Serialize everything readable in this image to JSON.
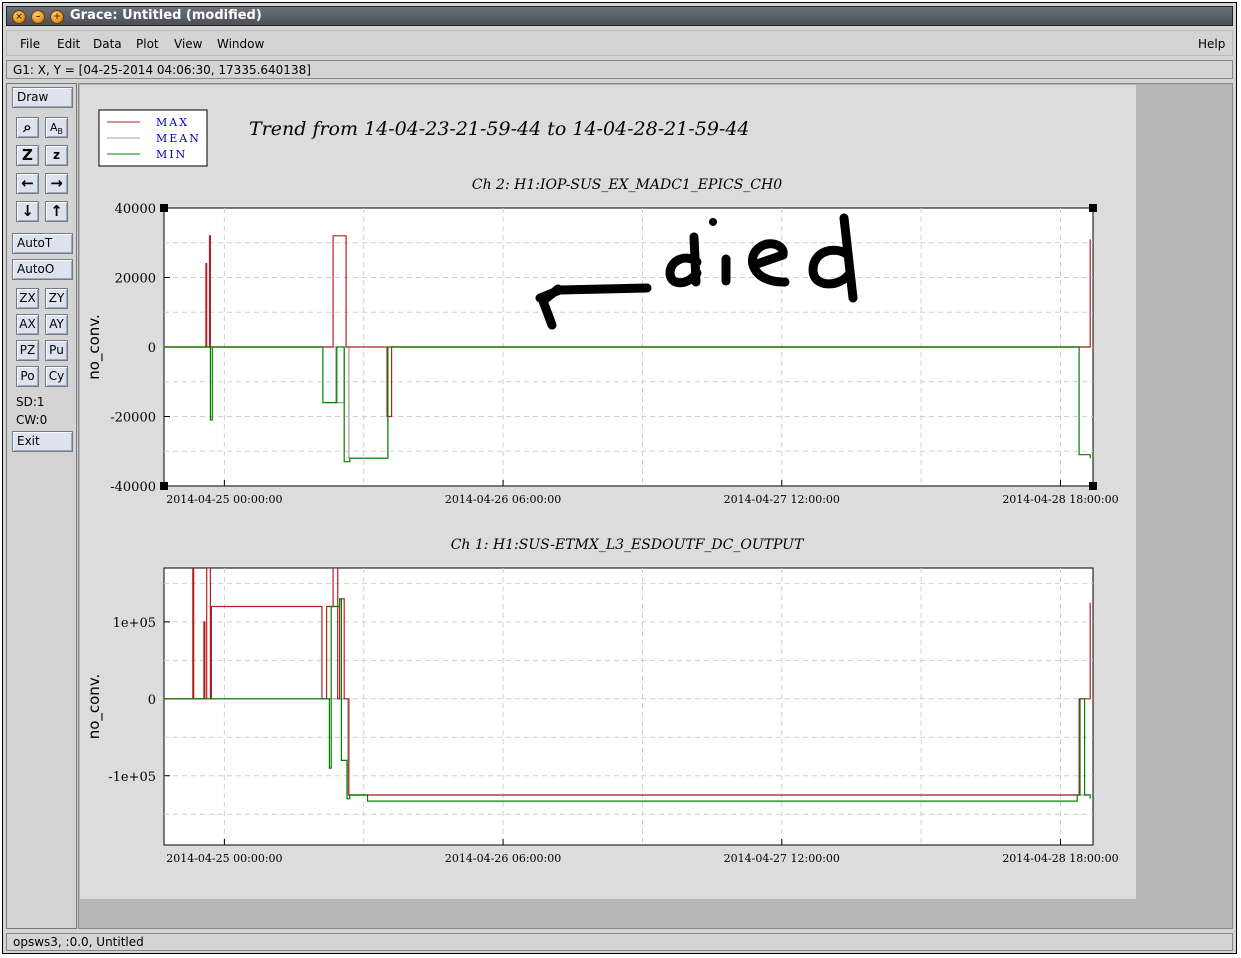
{
  "window": {
    "title": "Grace: Untitled (modified)",
    "buttons": [
      "close",
      "minimize",
      "maximize"
    ]
  },
  "menubar": {
    "items": [
      "File",
      "Edit",
      "Data",
      "Plot",
      "View",
      "Window"
    ],
    "help": "Help"
  },
  "locator": "G1: X, Y = [04-25-2014 04:06:30, 17335.640138]",
  "toolbox": {
    "draw": "Draw",
    "icons": [
      "zoom-icon",
      "text-icon",
      "zoom-in-icon",
      "zoom-out-icon",
      "arrow-left-icon",
      "arrow-right-icon",
      "arrow-down-icon",
      "arrow-up-icon"
    ],
    "autoT": "AutoT",
    "autoO": "AutoO",
    "pairs": [
      [
        "ZX",
        "ZY"
      ],
      [
        "AX",
        "AY"
      ],
      [
        "PZ",
        "Pu"
      ],
      [
        "Po",
        "Cy"
      ]
    ],
    "sd": "SD:1",
    "cw": "CW:0",
    "exit": "Exit"
  },
  "status": "opsws3, :0.0, Untitled",
  "colors": {
    "max": "#b22222",
    "mean": "#a0a0a0",
    "min": "#008000",
    "legend_text": "#0000cc"
  },
  "annotation": "died",
  "chart_data": [
    {
      "type": "line",
      "title": "Trend from 14-04-23-21-59-44 to 14-04-28-21-59-44",
      "subtitle": "Ch 2: H1:IOP-SUS_EX_MADC1_EPICS_CH0",
      "ylabel": "no_conv.",
      "xlabel": "",
      "ylim": [
        -40000,
        40000
      ],
      "yticks": [
        "40000",
        "20000",
        "0",
        "-20000",
        "-40000"
      ],
      "xticks": [
        "2014-04-25 00:00:00",
        "2014-04-26 06:00:00",
        "2014-04-27 12:00:00",
        "2014-04-28 18:00:00"
      ],
      "xlim_hours": [
        -6.5,
        93.5
      ],
      "grid": true,
      "legend": {
        "position": "top-left",
        "entries": [
          "MAX",
          "MEAN",
          "MIN"
        ]
      },
      "series": [
        {
          "name": "MAX",
          "x": [
            -19.6,
            -2.0,
            -1.99,
            -1.9,
            -1.6,
            -1.5,
            10.5,
            11.6,
            11.7,
            12.9,
            13.1,
            13.5,
            17.3,
            17.5,
            18.0,
            91.8,
            92.0,
            93.2
          ],
          "y": [
            0,
            0,
            24000,
            0,
            32000,
            0,
            0,
            0,
            32000,
            32000,
            0,
            0,
            0,
            -20000,
            0,
            0,
            0,
            31000
          ]
        },
        {
          "name": "MEAN",
          "x": [
            -19.6,
            10.5,
            12.0,
            12.9,
            13.4,
            17.5,
            17.6,
            93.2
          ],
          "y": [
            0,
            0,
            -16000,
            0,
            -32000,
            -32000,
            0,
            0
          ]
        },
        {
          "name": "MIN",
          "x": [
            -19.6,
            -2.0,
            -1.5,
            -1.3,
            10.5,
            10.6,
            11.9,
            12.1,
            12.9,
            13.5,
            17.5,
            17.6,
            91.8,
            92.0,
            93.2
          ],
          "y": [
            0,
            0,
            -21000,
            0,
            0,
            -16000,
            -16000,
            0,
            -33000,
            -32000,
            -32000,
            0,
            0,
            -31000,
            -32000
          ]
        }
      ]
    },
    {
      "type": "line",
      "title": "",
      "subtitle": "Ch 1: H1:SUS-ETMX_L3_ESDOUTF_DC_OUTPUT",
      "ylabel": "no_conv.",
      "xlabel": "",
      "ylim": [
        -190000,
        170000
      ],
      "yticks": [
        "1e+05",
        "0",
        "-1e+05"
      ],
      "xticks": [
        "2014-04-25 00:00:00",
        "2014-04-26 06:00:00",
        "2014-04-27 12:00:00",
        "2014-04-28 18:00:00"
      ],
      "xlim_hours": [
        -6.5,
        93.5
      ],
      "grid": true,
      "series": [
        {
          "name": "MAX",
          "x": [
            -19.6,
            -3.5,
            -3.4,
            -3.3,
            -2.2,
            -2.1,
            -1.9,
            -1.5,
            -1.4,
            10.5,
            11.0,
            11.7,
            12.2,
            12.4,
            12.9,
            13.4,
            91.8,
            92.0,
            93.2
          ],
          "y": [
            0,
            0,
            170000,
            0,
            100000,
            0,
            170000,
            0,
            120000,
            0,
            120000,
            170000,
            0,
            130000,
            0,
            -125000,
            -125000,
            0,
            125000
          ]
        },
        {
          "name": "MEAN",
          "x": [
            -19.6,
            11.0,
            12.5,
            13.3,
            93.2
          ],
          "y": [
            0,
            0,
            0,
            -125000,
            -125000
          ]
        },
        {
          "name": "MIN",
          "x": [
            -19.6,
            11.1,
            11.3,
            11.5,
            12.4,
            12.6,
            13.2,
            13.5,
            15.4,
            91.8,
            92.1,
            92.6,
            93.2
          ],
          "y": [
            0,
            0,
            -90000,
            120000,
            130000,
            -80000,
            -130000,
            -125000,
            -133000,
            -125000,
            0,
            -125000,
            -130000
          ]
        }
      ]
    }
  ]
}
